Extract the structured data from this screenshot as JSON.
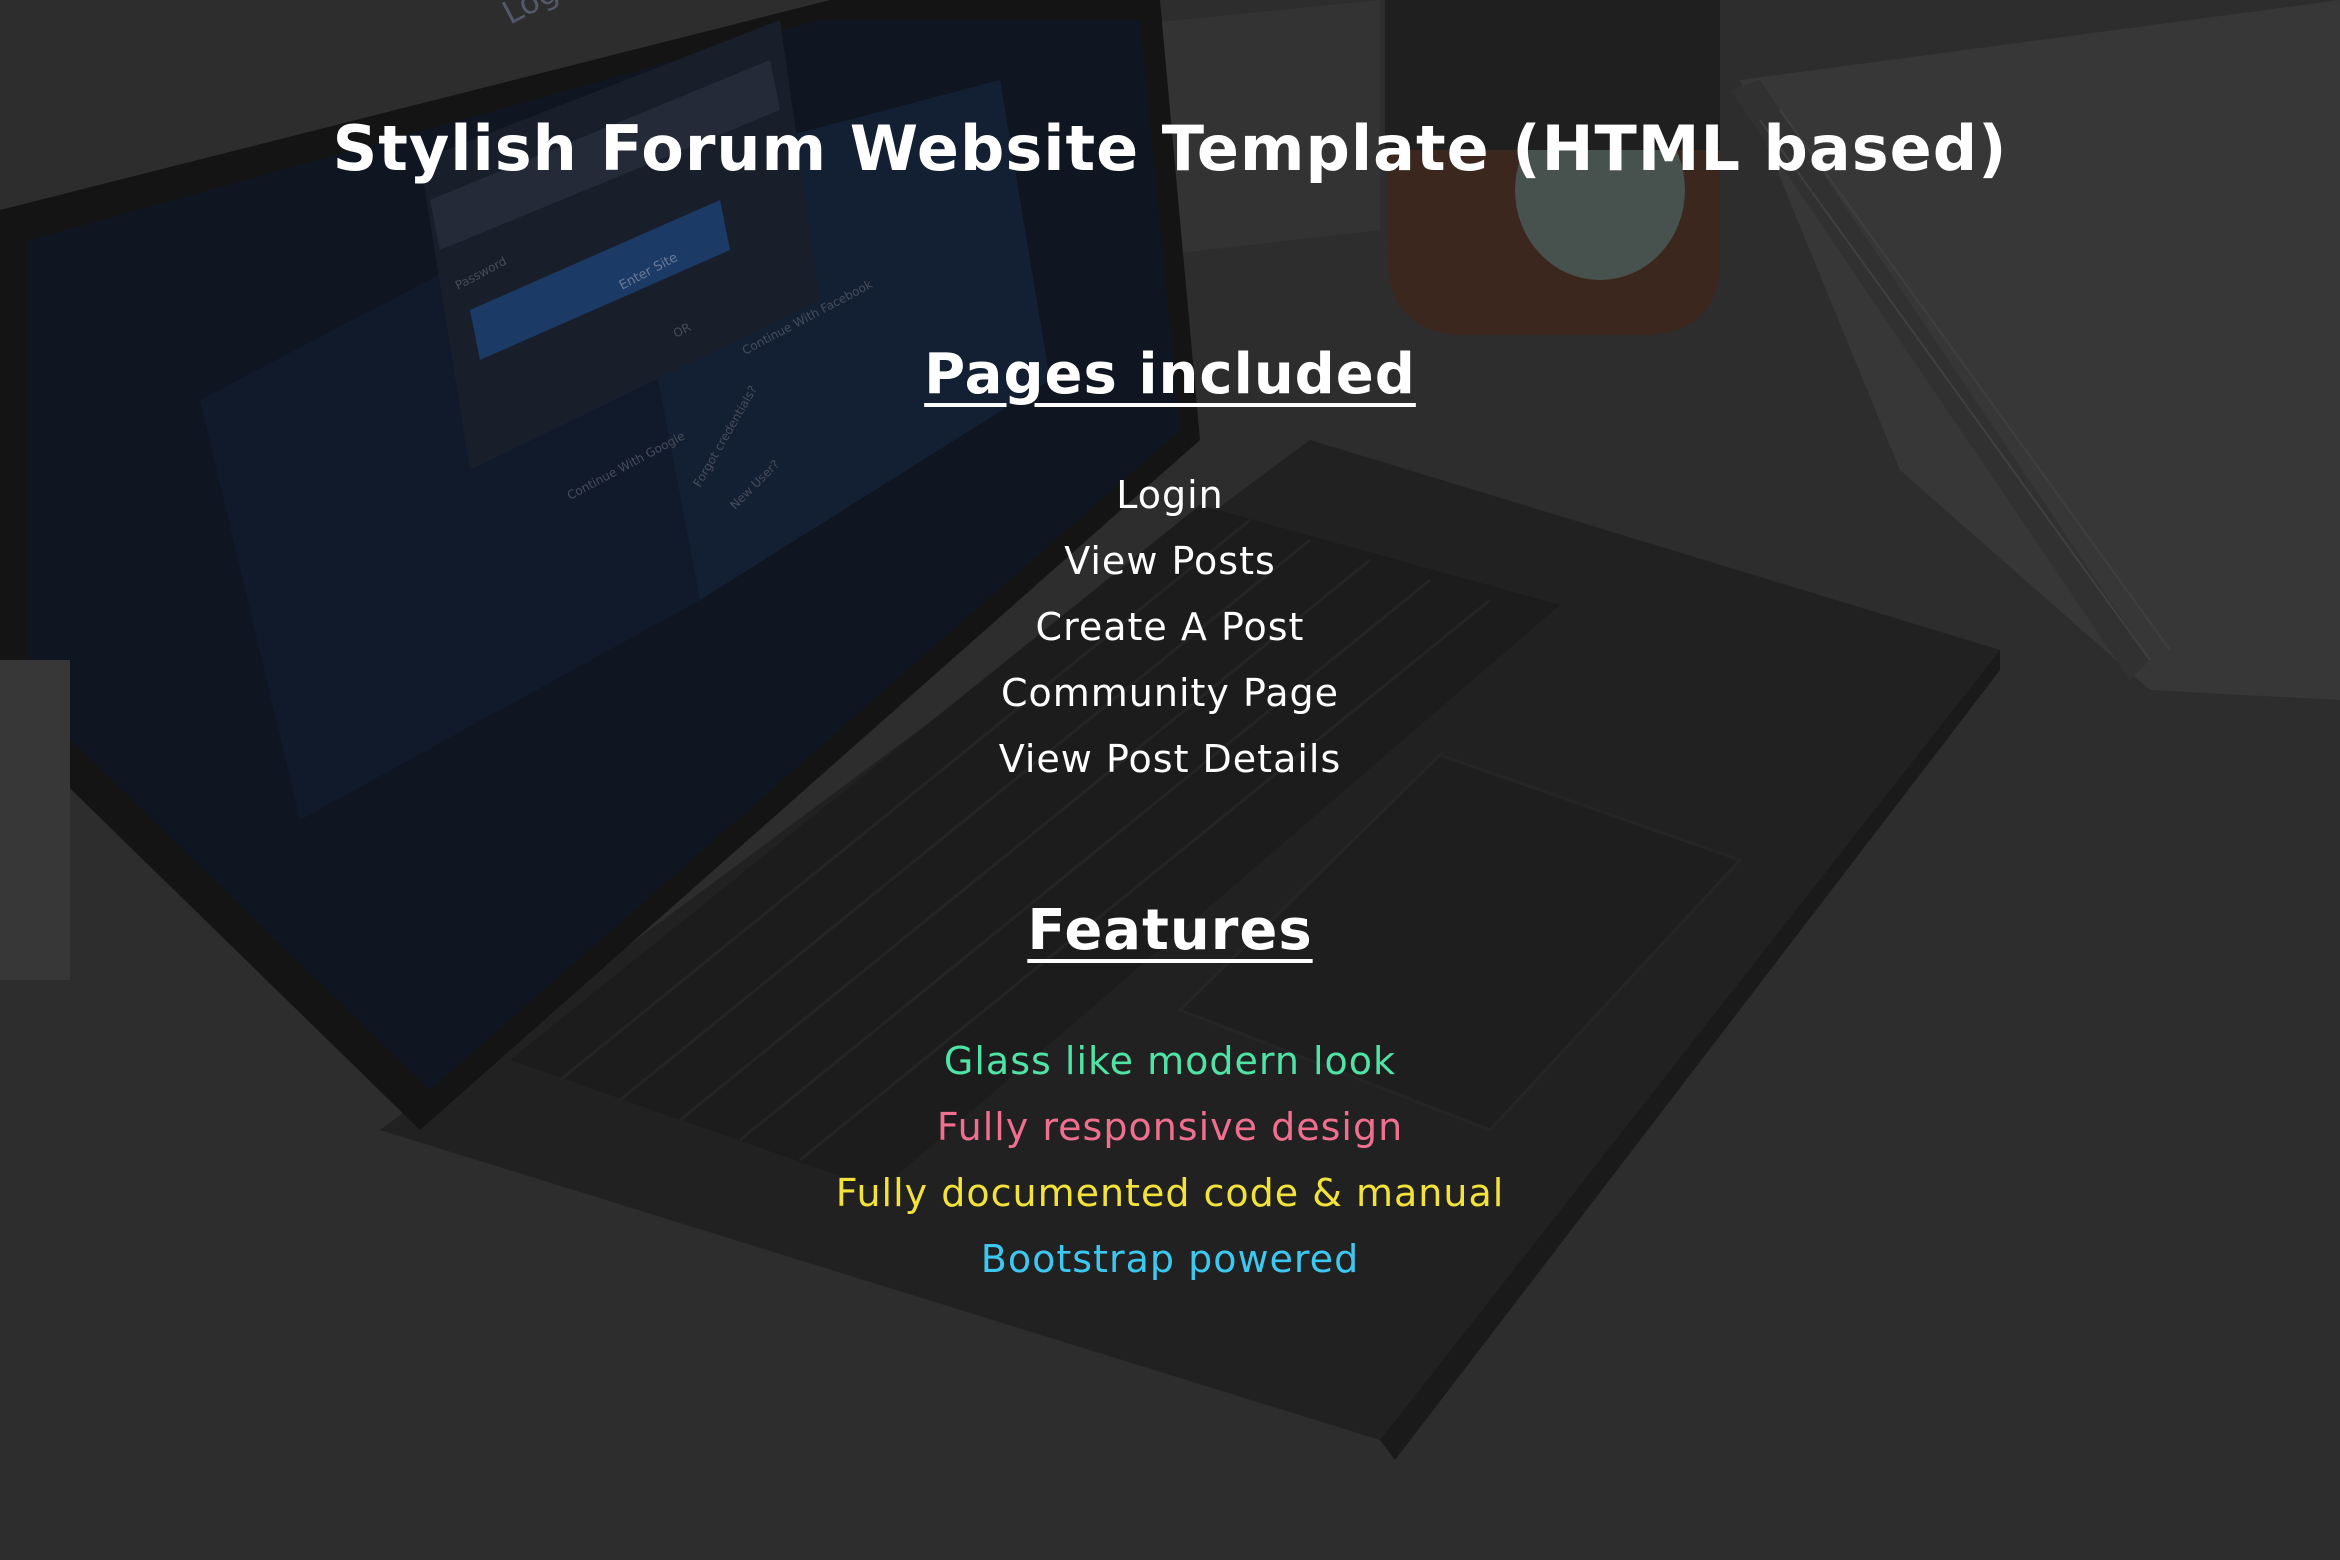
{
  "title": "Stylish Forum Website Template (HTML based)",
  "pages_section": {
    "heading": "Pages included",
    "items": [
      {
        "label": "Login"
      },
      {
        "label": "View Posts"
      },
      {
        "label": "Create A Post"
      },
      {
        "label": "Community Page"
      },
      {
        "label": "View Post Details"
      }
    ]
  },
  "features_section": {
    "heading": "Features",
    "items": [
      {
        "label": "Glass like modern look",
        "color": "#4fe3a6"
      },
      {
        "label": "Fully responsive design",
        "color": "#f06f8e"
      },
      {
        "label": "Fully documented code & manual",
        "color": "#f2e23a"
      },
      {
        "label": "Bootstrap powered",
        "color": "#3cc8f0"
      }
    ]
  },
  "background": {
    "screen_text": {
      "login_heading": "Log",
      "password_placeholder": "Password",
      "enter_site": "Enter Site",
      "or": "OR",
      "continue_google": "Continue With Google",
      "continue_facebook": "Continue With Facebook",
      "forgot": "Forgot credentials?",
      "new_user": "New User?"
    }
  }
}
